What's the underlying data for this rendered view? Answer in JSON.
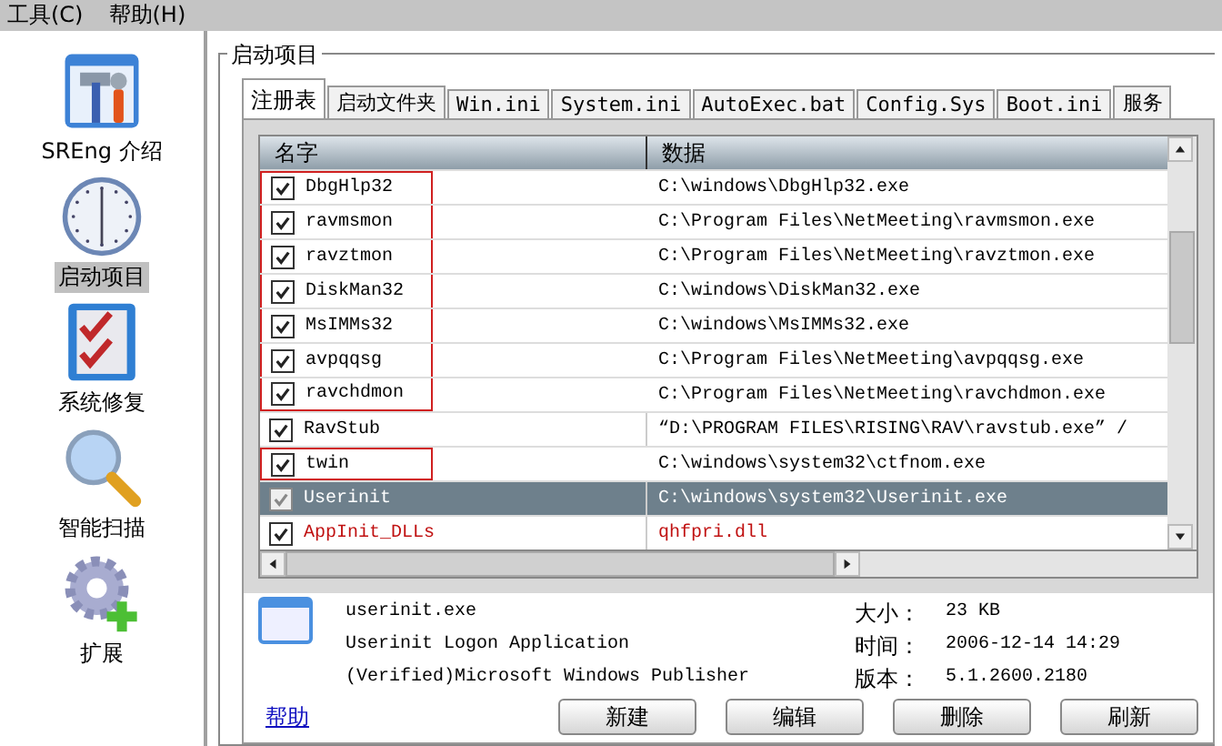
{
  "menu": [
    {
      "label": "工具(C)"
    },
    {
      "label": "帮助(H)"
    }
  ],
  "sidebar": {
    "items": [
      {
        "label": "SREng 介绍",
        "selected": false,
        "kind": "tools"
      },
      {
        "label": "启动项目",
        "selected": true,
        "kind": "clock"
      },
      {
        "label": "系统修复",
        "selected": false,
        "kind": "checklist"
      },
      {
        "label": "智能扫描",
        "selected": false,
        "kind": "magnifier"
      },
      {
        "label": "扩展",
        "selected": false,
        "kind": "gear"
      }
    ]
  },
  "group": {
    "title": "启动项目"
  },
  "tabs": [
    {
      "label": "注册表",
      "selected": true
    },
    {
      "label": "启动文件夹",
      "selected": false
    },
    {
      "label": "Win.ini",
      "selected": false
    },
    {
      "label": "System.ini",
      "selected": false
    },
    {
      "label": "AutoExec.bat",
      "selected": false
    },
    {
      "label": "Config.Sys",
      "selected": false
    },
    {
      "label": "Boot.ini",
      "selected": false
    },
    {
      "label": "服务",
      "selected": false
    }
  ],
  "table": {
    "columns": [
      "名字",
      "数据"
    ],
    "rows": [
      {
        "name": "DbgHlp32",
        "data": "C:\\windows\\DbgHlp32.exe",
        "checked": true,
        "selected": false,
        "flagged": true,
        "warning": false
      },
      {
        "name": "ravmsmon",
        "data": "C:\\Program Files\\NetMeeting\\ravmsmon.exe",
        "checked": true,
        "selected": false,
        "flagged": true,
        "warning": false
      },
      {
        "name": "ravztmon",
        "data": "C:\\Program Files\\NetMeeting\\ravztmon.exe",
        "checked": true,
        "selected": false,
        "flagged": true,
        "warning": false
      },
      {
        "name": "DiskMan32",
        "data": "C:\\windows\\DiskMan32.exe",
        "checked": true,
        "selected": false,
        "flagged": true,
        "warning": false
      },
      {
        "name": "MsIMMs32",
        "data": "C:\\windows\\MsIMMs32.exe",
        "checked": true,
        "selected": false,
        "flagged": true,
        "warning": false
      },
      {
        "name": "avpqqsg",
        "data": "C:\\Program Files\\NetMeeting\\avpqqsg.exe",
        "checked": true,
        "selected": false,
        "flagged": true,
        "warning": false
      },
      {
        "name": "ravchdmon",
        "data": "C:\\Program Files\\NetMeeting\\ravchdmon.exe",
        "checked": true,
        "selected": false,
        "flagged": true,
        "warning": false
      },
      {
        "name": "RavStub",
        "data": "“D:\\PROGRAM FILES\\RISING\\RAV\\ravstub.exe” /",
        "checked": true,
        "selected": false,
        "flagged": false,
        "warning": false
      },
      {
        "name": "twin",
        "data": "C:\\windows\\system32\\ctfnom.exe",
        "checked": true,
        "selected": false,
        "flagged": true,
        "warning": false
      },
      {
        "name": "Userinit",
        "data": "C:\\windows\\system32\\Userinit.exe",
        "checked": true,
        "selected": true,
        "flagged": false,
        "warning": false
      },
      {
        "name": "AppInit_DLLs",
        "data": "qhfpri.dll",
        "checked": true,
        "selected": false,
        "flagged": false,
        "warning": true
      }
    ]
  },
  "details": {
    "lines": [
      "userinit.exe",
      "Userinit Logon Application",
      "(Verified)Microsoft Windows Publisher"
    ],
    "fields": [
      {
        "label": "大小：",
        "value": "23 KB"
      },
      {
        "label": "时间：",
        "value": "2006-12-14 14:29"
      },
      {
        "label": "版本：",
        "value": "5.1.2600.2180"
      }
    ]
  },
  "help_link": "帮助",
  "buttons": [
    "新建",
    "编辑",
    "删除",
    "刷新"
  ]
}
